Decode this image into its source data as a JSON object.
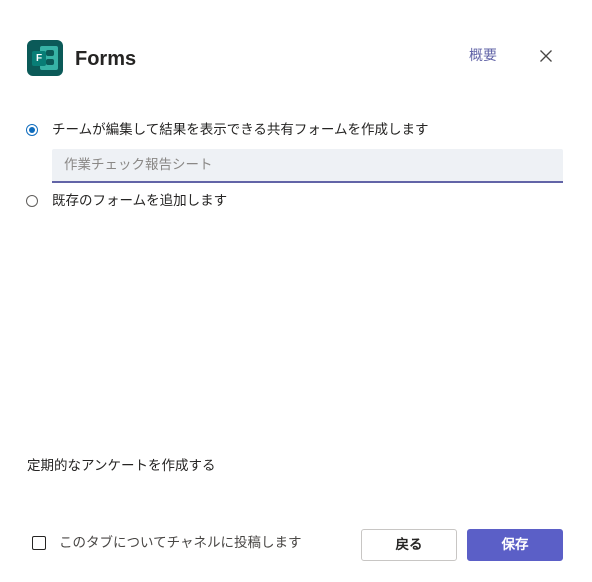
{
  "header": {
    "app_title": "Forms",
    "app_icon": "forms-logo-icon",
    "icon_letter": "F",
    "about_label": "概要",
    "close_icon": "close-icon"
  },
  "options": {
    "create_new_label": "チームが編集して結果を表示できる共有フォームを作成します",
    "create_new_selected": true,
    "form_name_value": "",
    "form_name_placeholder": "作業チェック報告シート",
    "add_existing_label": "既存のフォームを追加します",
    "add_existing_selected": false
  },
  "recurring_survey_text": "定期的なアンケートを作成する",
  "footer": {
    "post_to_channel_label": "このタブについてチャネルに投稿します",
    "post_to_channel_checked": false,
    "back_label": "戻る",
    "save_label": "保存"
  },
  "colors": {
    "accent": "#6264a7",
    "primary_button": "#5b5fc7",
    "radio_selected": "#0f6cbd",
    "forms_brand": "#0b5a58"
  }
}
